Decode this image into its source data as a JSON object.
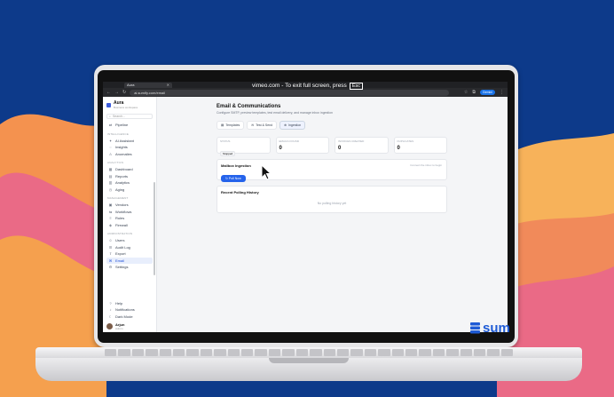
{
  "colors": {
    "background": "#0d3a8a",
    "wave_orange": "#f4924f",
    "wave_pink": "#ea6a86",
    "accent": "#2563eb"
  },
  "browser": {
    "tab_title": "Aura",
    "fullscreen_notice": "vimeo.com - To exit full screen, press",
    "fullscreen_key": "Esc",
    "url": "ai.sumify.com/email",
    "ai_button": "Gemini"
  },
  "sidebar": {
    "brand": "Aura",
    "brand_sub": "Business workspace",
    "search_placeholder": "Search...",
    "items_top": [
      {
        "label": "Pipeline",
        "icon": "pipeline-icon"
      }
    ],
    "sections": [
      {
        "title": "INTELLIGENCE",
        "items": [
          {
            "label": "AI Assistant",
            "icon": "sparkle-icon"
          },
          {
            "label": "Insights",
            "icon": "lightbulb-icon"
          },
          {
            "label": "Anomalies",
            "icon": "alert-icon"
          }
        ]
      },
      {
        "title": "ANALYTICS",
        "items": [
          {
            "label": "Dashboard",
            "icon": "dashboard-icon"
          },
          {
            "label": "Reports",
            "icon": "report-icon"
          },
          {
            "label": "Analytics",
            "icon": "chart-icon"
          },
          {
            "label": "Aging",
            "icon": "clock-icon"
          }
        ]
      },
      {
        "title": "MANAGEMENT",
        "items": [
          {
            "label": "Vendors",
            "icon": "building-icon"
          },
          {
            "label": "Workflows",
            "icon": "workflow-icon"
          },
          {
            "label": "Rules",
            "icon": "rules-icon"
          },
          {
            "label": "Firewall",
            "icon": "shield-icon"
          }
        ]
      },
      {
        "title": "ADMINISTRATION",
        "items": [
          {
            "label": "Users",
            "icon": "users-icon"
          },
          {
            "label": "Audit Log",
            "icon": "log-icon"
          },
          {
            "label": "Export",
            "icon": "export-icon"
          },
          {
            "label": "Email",
            "icon": "mail-icon",
            "active": true
          },
          {
            "label": "Settings",
            "icon": "gear-icon"
          }
        ]
      }
    ],
    "footer_items": [
      {
        "label": "Help",
        "icon": "help-icon"
      },
      {
        "label": "Notifications",
        "icon": "bell-icon"
      },
      {
        "label": "Dark Mode",
        "icon": "moon-icon"
      }
    ],
    "user_name": "Arjun",
    "user_role": "Admin"
  },
  "main": {
    "title": "Email & Communications",
    "subtitle": "Configure SMTP, preview templates, test email delivery, and manage inbox ingestion",
    "tabs": [
      "Templates",
      "Test & Send",
      "Ingestion"
    ],
    "selected_tab": "Ingestion",
    "stats": [
      {
        "label": "STATUS",
        "value": "",
        "pill": "Stopped"
      },
      {
        "label": "EMAILS FOUND",
        "value": "0"
      },
      {
        "label": "INVOICES CREATED",
        "value": "0"
      },
      {
        "label": "DUPLICATES",
        "value": "0"
      }
    ],
    "mailbox": {
      "title": "Mailbox Ingestion",
      "right_text": "Connect the inbox to begin",
      "button": "Poll Now"
    },
    "history": {
      "title": "Recent Polling History",
      "empty_text": "No polling history yet"
    }
  },
  "watermark": "sum"
}
